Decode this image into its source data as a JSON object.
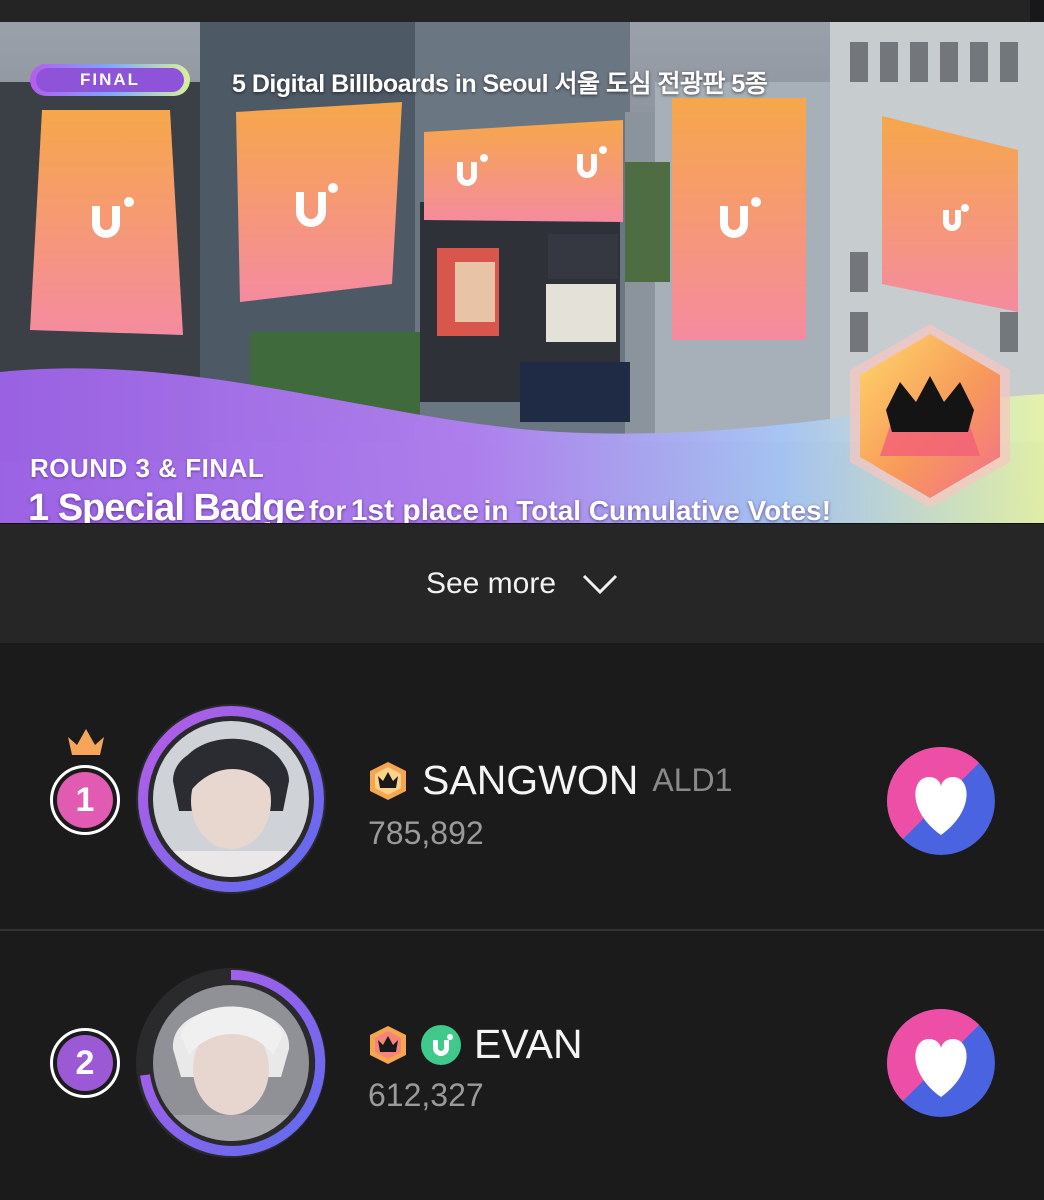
{
  "banner": {
    "tag": "FINAL",
    "headline": "5 Digital Billboards in Seoul 서울 도심 전광판 5종",
    "round": "ROUND 3 & FINAL",
    "badge_big": "1 Special Badge",
    "badge_mid1": "for",
    "badge_bold": "1st place",
    "badge_mid2": "in Total Cumulative Votes!"
  },
  "see_more": {
    "label": "See more"
  },
  "ranking": [
    {
      "rank": "1",
      "name": "SANGWON",
      "group": "ALD1",
      "votes": "785,892",
      "rank_color": "#e25bb3"
    },
    {
      "rank": "2",
      "name": "EVAN",
      "group": "",
      "votes": "612,327",
      "rank_color": "#9b59d6"
    }
  ],
  "colors": {
    "background": "#1b1b1b",
    "pink": "#ee4fa6",
    "blue": "#4a63e0",
    "gold": "#f5a65b"
  }
}
